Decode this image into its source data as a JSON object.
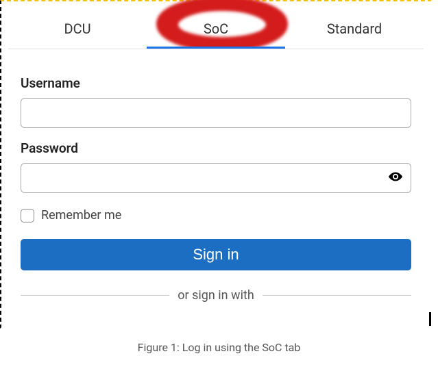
{
  "tabs": {
    "dcu": "DCU",
    "soc": "SoC",
    "standard": "Standard"
  },
  "form": {
    "username_label": "Username",
    "password_label": "Password",
    "remember_label": "Remember me",
    "signin_label": "Sign in",
    "divider_text": "or sign in with"
  },
  "caption": "Figure 1: Log in using the SoC tab",
  "annotation": {
    "type": "freehand-circle",
    "color": "#d41c1c",
    "target": "tab-soc"
  }
}
